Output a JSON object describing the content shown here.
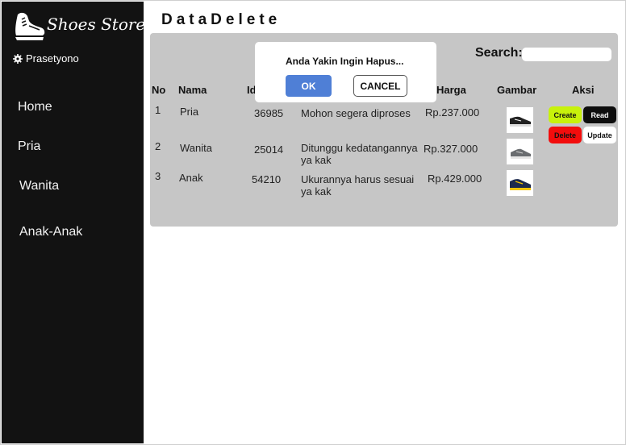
{
  "sidebar": {
    "brand": "Shoes Store",
    "user": "Prasetyono",
    "nav": [
      "Home",
      "Pria",
      "Wanita",
      "Anak-Anak"
    ]
  },
  "page": {
    "title": "DataDelete"
  },
  "search": {
    "label": "Search:",
    "value": ""
  },
  "table": {
    "headers": [
      "No",
      "Nama",
      "Id",
      "Harga",
      "Gambar",
      "Aksi"
    ],
    "rows": [
      {
        "no": "1",
        "nama": "Pria",
        "id": "36985",
        "ket": "Mohon segera diproses",
        "harga": "Rp.237.000",
        "gambar": "shoe-black-white"
      },
      {
        "no": "2",
        "nama": "Wanita",
        "id": "25014",
        "ket": "Ditunggu kedatangannya ya kak",
        "harga": "Rp.327.000",
        "gambar": "shoe-grey"
      },
      {
        "no": "3",
        "nama": "Anak",
        "id": "54210",
        "ket": "Ukurannya harus sesuai ya kak",
        "harga": "Rp.429.000",
        "gambar": "shoe-navy-yellow"
      }
    ]
  },
  "actions": {
    "create": "Create",
    "read": "Read",
    "delete": "Delete",
    "update": "Update"
  },
  "dialog": {
    "message": "Anda Yakin Ingin Hapus...",
    "ok": "OK",
    "cancel": "CANCEL"
  },
  "colors": {
    "sidebar": "#121212",
    "panel": "#c6c6c6",
    "create": "#c8f20b",
    "read": "#0d0d0d",
    "delete": "#f20d0d",
    "ok": "#4f7fd6"
  }
}
